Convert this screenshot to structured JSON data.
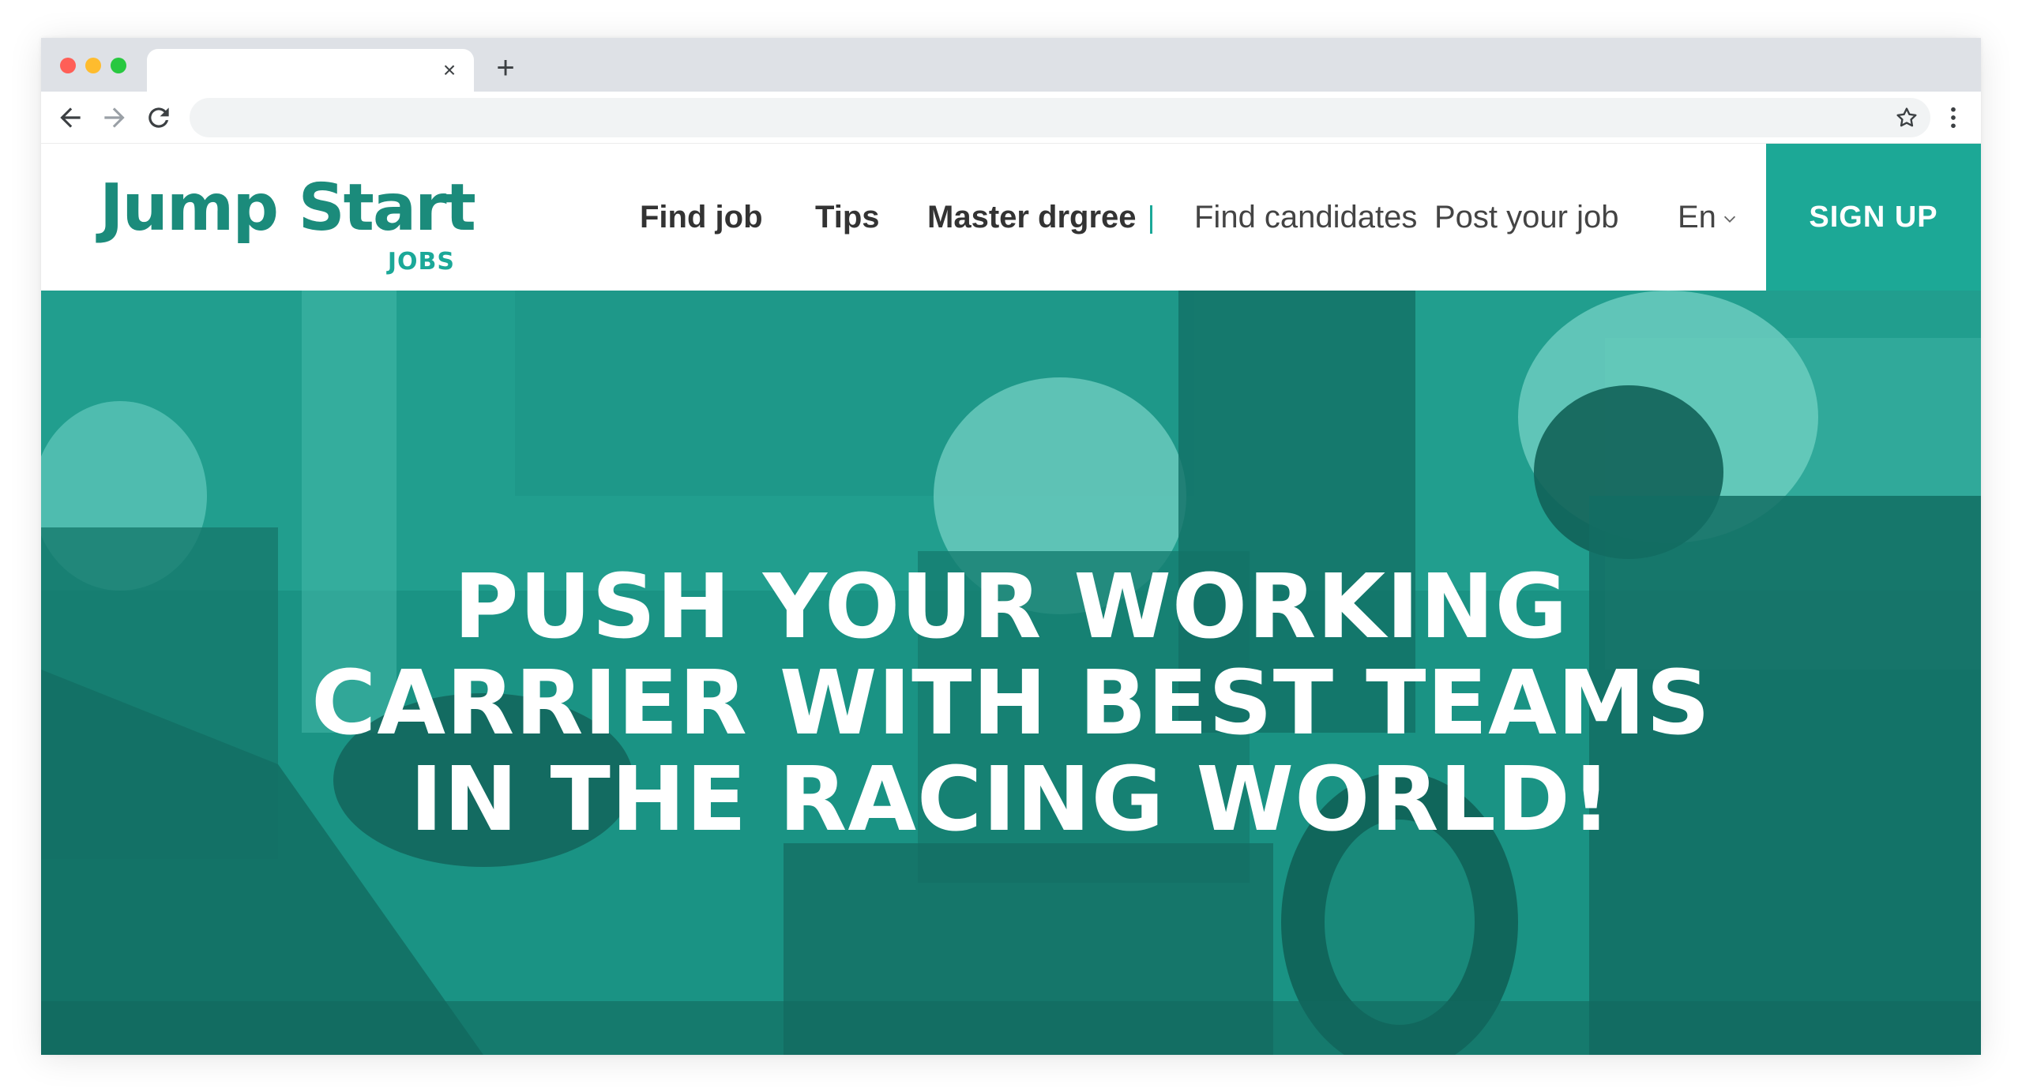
{
  "browser": {
    "tab_close_glyph": "×",
    "new_tab_glyph": "+",
    "address_value": ""
  },
  "site": {
    "logo": {
      "main": "Jump Start",
      "sub": "JOBS"
    },
    "nav": {
      "find_job": "Find job",
      "tips": "Tips",
      "master_degree": "Master drgree",
      "find_candidates": "Find candidates",
      "post_job": "Post your job",
      "language": "En"
    },
    "signup_label": "SIGN UP"
  },
  "hero": {
    "lines": [
      "PUSH YOUR WORKING",
      "CARRIER WITH BEST TEAMS",
      "IN THE RACING WORLD!"
    ]
  },
  "colors": {
    "brand": "#1ca896",
    "brand_dark": "#1b8b7b",
    "hero_tint": "#1b8f80"
  }
}
